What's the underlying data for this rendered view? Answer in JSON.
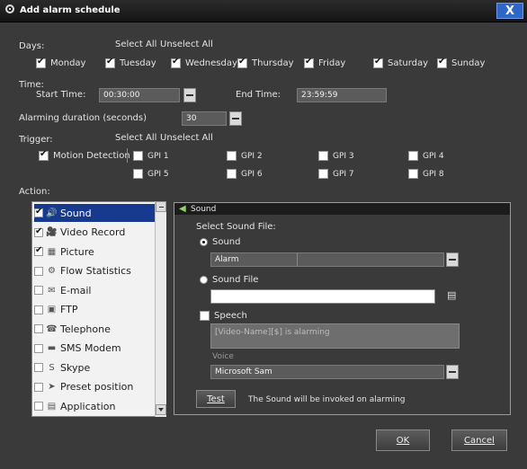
{
  "window": {
    "title": "Add alarm schedule",
    "close_symbol": "X"
  },
  "days": {
    "label": "Days:",
    "select_all": "Select All",
    "unselect_all": "Unselect All",
    "items": [
      {
        "label": "Monday",
        "checked": true
      },
      {
        "label": "Tuesday",
        "checked": true
      },
      {
        "label": "Wednesday",
        "checked": true
      },
      {
        "label": "Thursday",
        "checked": true
      },
      {
        "label": "Friday",
        "checked": true
      },
      {
        "label": "Saturday",
        "checked": true
      },
      {
        "label": "Sunday",
        "checked": true
      }
    ]
  },
  "time": {
    "label": "Time:",
    "start_label": "Start Time:",
    "start_value": "00:30:00",
    "end_label": "End Time:",
    "end_value": "23:59:59"
  },
  "duration": {
    "label": "Alarming duration (seconds)",
    "value": "30"
  },
  "trigger": {
    "label": "Trigger:",
    "select_all": "Select All",
    "unselect_all": "Unselect All",
    "motion_label": "Motion Detection",
    "motion_checked": true,
    "gpi": [
      "GPI 1",
      "GPI 2",
      "GPI 3",
      "GPI 4",
      "GPI 5",
      "GPI 6",
      "GPI 7",
      "GPI 8"
    ]
  },
  "action": {
    "label": "Action:",
    "items": [
      {
        "label": "Sound",
        "checked": true,
        "icon": "speaker-icon",
        "glyph": "🔊",
        "selected": true
      },
      {
        "label": "Video Record",
        "checked": true,
        "icon": "video-icon",
        "glyph": "🎥"
      },
      {
        "label": "Picture",
        "checked": true,
        "icon": "picture-icon",
        "glyph": "▦"
      },
      {
        "label": "Flow Statistics",
        "checked": false,
        "icon": "flow-icon",
        "glyph": "⚙"
      },
      {
        "label": "E-mail",
        "checked": false,
        "icon": "email-icon",
        "glyph": "✉"
      },
      {
        "label": "FTP",
        "checked": false,
        "icon": "ftp-icon",
        "glyph": "▣"
      },
      {
        "label": "Telephone",
        "checked": false,
        "icon": "telephone-icon",
        "glyph": "☎"
      },
      {
        "label": "SMS Modem",
        "checked": false,
        "icon": "modem-icon",
        "glyph": "▬"
      },
      {
        "label": "Skype",
        "checked": false,
        "icon": "skype-icon",
        "glyph": "S"
      },
      {
        "label": "Preset position",
        "checked": false,
        "icon": "preset-icon",
        "glyph": "➤"
      },
      {
        "label": "Application",
        "checked": false,
        "icon": "application-icon",
        "glyph": "▤"
      }
    ]
  },
  "sound_panel": {
    "title": "Sound",
    "select_sound_file": "Select Sound File:",
    "sound_radio": "Sound",
    "sound_value": "Alarm",
    "sound_file_radio": "Sound File",
    "sound_file_value": "",
    "speech_label": "Speech",
    "speech_text": "[Video-Name][$] is alarming",
    "voice_label": "Voice",
    "voice_value": "Microsoft Sam",
    "test_button": "Test",
    "info_text": "The Sound will be invoked on alarming"
  },
  "footer": {
    "ok": "OK",
    "cancel": "Cancel"
  },
  "colors": {
    "accent": "#173a8e",
    "background": "#3a3a3a",
    "close": "#2f67c9"
  }
}
